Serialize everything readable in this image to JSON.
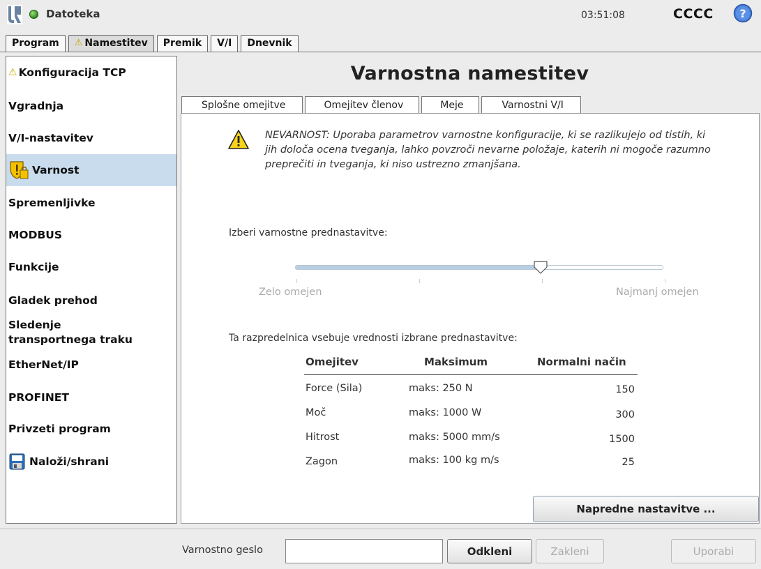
{
  "topbar": {
    "file_menu": "Datoteka",
    "clock": "03:51:08",
    "robot_name": "CCCC"
  },
  "main_tabs": [
    {
      "label": "Program"
    },
    {
      "label": "Namestitev",
      "warning": true
    },
    {
      "label": "Premik"
    },
    {
      "label": "V/I"
    },
    {
      "label": "Dnevnik"
    }
  ],
  "sidebar": {
    "items": [
      {
        "label": "Konfiguracija TCP"
      },
      {
        "label": "Vgradnja"
      },
      {
        "label": "V/I-nastavitev"
      },
      {
        "label": "Varnost"
      },
      {
        "label": "Spremenljivke"
      },
      {
        "label": "MODBUS"
      },
      {
        "label": "Funkcije"
      },
      {
        "label": "Gladek prehod"
      },
      {
        "label_line1": "Sledenje",
        "label_line2": "transportnega traku"
      },
      {
        "label": "EtherNet/IP"
      },
      {
        "label": "PROFINET"
      },
      {
        "label": "Privzeti program"
      },
      {
        "label": "Naloži/shrani"
      }
    ]
  },
  "main": {
    "title": "Varnostna namestitev",
    "sub_tabs": [
      {
        "label": "Splošne omejitve"
      },
      {
        "label": "Omejitev členov"
      },
      {
        "label": "Meje"
      },
      {
        "label": "Varnostni V/I"
      }
    ],
    "danger_text": "NEVARNOST: Uporaba parametrov varnostne konfiguracije, ki se razlikujejo od tistih, ki jih določa ocena tveganja, lahko povzroči nevarne položaje, katerih ni mogoče razumno preprečiti in tveganja, ki niso ustrezno zmanjšana.",
    "preset_label": "Izberi varnostne prednastavitve:",
    "slider": {
      "min_label": "Zelo omejen",
      "max_label": "Najmanj omejen",
      "value_fraction": 0.667
    },
    "table_caption": "Ta razpredelnica vsebuje vrednosti izbrane prednastavitve:",
    "table": {
      "headers": [
        "Omejitev",
        "Maksimum",
        "Normalni način"
      ],
      "rows": [
        [
          "Force (Sila)",
          "maks: 250 N",
          "150"
        ],
        [
          "Moč",
          "maks: 1000 W",
          "300"
        ],
        [
          "Hitrost",
          "maks: 5000 mm/s",
          "1500"
        ],
        [
          "Zagon",
          "maks: 100 kg m/s",
          "25"
        ]
      ]
    },
    "advanced_button": "Napredne nastavitve ..."
  },
  "bottom": {
    "password_label": "Varnostno geslo",
    "password_value": "",
    "unlock_button": "Odkleni",
    "lock_button": "Zakleni",
    "apply_button": "Uporabi"
  },
  "colors": {
    "active_sidebar": "#c9dced",
    "warning": "#f2c200",
    "status_ok": "#2e8b1e"
  }
}
